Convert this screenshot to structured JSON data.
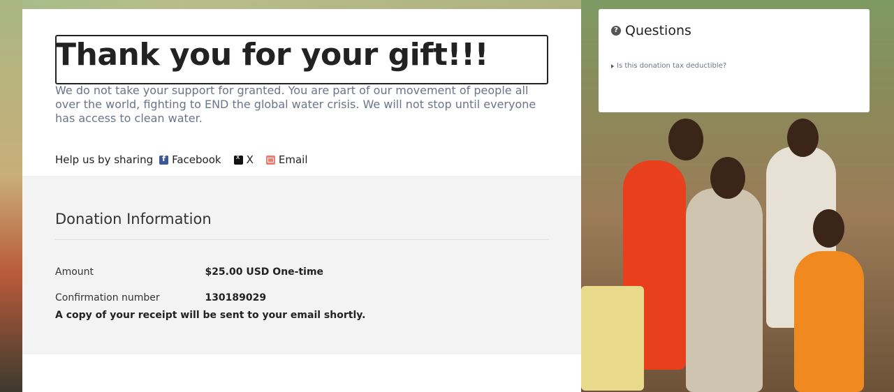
{
  "header": {
    "title": "Thank you for your gift!!!",
    "message": "We do not take your support for granted. You are part of our movement of people all over the world, fighting to END the global water crisis. We will not stop until everyone has access to clean water."
  },
  "share": {
    "label": "Help us by sharing",
    "links": [
      {
        "label": "Facebook",
        "icon": "facebook-icon"
      },
      {
        "label": "X",
        "icon": "x-icon"
      },
      {
        "label": "Email",
        "icon": "email-icon"
      }
    ]
  },
  "donation": {
    "heading": "Donation Information",
    "amount_label": "Amount",
    "amount_value": "$25.00 USD One-time",
    "confirmation_label": "Confirmation number",
    "confirmation_value": "130189029",
    "receipt_note": "A copy of your receipt will be sent to your email shortly."
  },
  "questions": {
    "title": "Questions",
    "icon": "question-circle-icon",
    "items": [
      {
        "label": "Is this donation tax deductible?"
      }
    ]
  },
  "colors": {
    "text_muted": "#6b7488",
    "facebook": "#3b5998",
    "email": "#f07b6f",
    "info_bg": "#f3f3f3"
  }
}
